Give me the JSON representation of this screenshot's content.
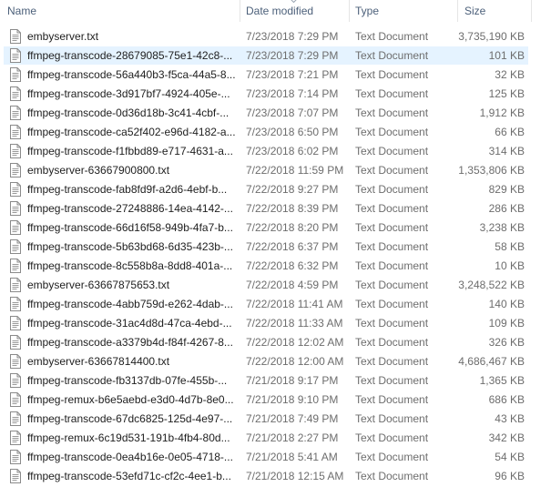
{
  "columns": {
    "name": "Name",
    "date_modified": "Date modified",
    "type": "Type",
    "size": "Size"
  },
  "sort": {
    "column": "date_modified",
    "direction": "descending"
  },
  "selection_color": "#e5f3ff",
  "files": [
    {
      "name": "embyserver.txt",
      "date": "7/23/2018 7:29 PM",
      "type": "Text Document",
      "size": "3,735,190 KB",
      "icon": "text-file-icon",
      "selected": false
    },
    {
      "name": "ffmpeg-transcode-28679085-75e1-42c8-...",
      "date": "7/23/2018 7:29 PM",
      "type": "Text Document",
      "size": "101 KB",
      "icon": "text-file-icon",
      "selected": true
    },
    {
      "name": "ffmpeg-transcode-56a440b3-f5ca-44a5-8...",
      "date": "7/23/2018 7:21 PM",
      "type": "Text Document",
      "size": "32 KB",
      "icon": "text-file-icon",
      "selected": false
    },
    {
      "name": "ffmpeg-transcode-3d917bf7-4924-405e-...",
      "date": "7/23/2018 7:14 PM",
      "type": "Text Document",
      "size": "125 KB",
      "icon": "text-file-icon",
      "selected": false
    },
    {
      "name": "ffmpeg-transcode-0d36d18b-3c41-4cbf-...",
      "date": "7/23/2018 7:07 PM",
      "type": "Text Document",
      "size": "1,912 KB",
      "icon": "text-file-icon",
      "selected": false
    },
    {
      "name": "ffmpeg-transcode-ca52f402-e96d-4182-a...",
      "date": "7/23/2018 6:50 PM",
      "type": "Text Document",
      "size": "66 KB",
      "icon": "text-file-icon",
      "selected": false
    },
    {
      "name": "ffmpeg-transcode-f1fbbd89-e717-4631-a...",
      "date": "7/23/2018 6:02 PM",
      "type": "Text Document",
      "size": "314 KB",
      "icon": "text-file-icon",
      "selected": false
    },
    {
      "name": "embyserver-63667900800.txt",
      "date": "7/22/2018 11:59 PM",
      "type": "Text Document",
      "size": "1,353,806 KB",
      "icon": "text-file-icon",
      "selected": false
    },
    {
      "name": "ffmpeg-transcode-fab8fd9f-a2d6-4ebf-b...",
      "date": "7/22/2018 9:27 PM",
      "type": "Text Document",
      "size": "829 KB",
      "icon": "text-file-icon",
      "selected": false
    },
    {
      "name": "ffmpeg-transcode-27248886-14ea-4142-...",
      "date": "7/22/2018 8:39 PM",
      "type": "Text Document",
      "size": "286 KB",
      "icon": "text-file-icon",
      "selected": false
    },
    {
      "name": "ffmpeg-transcode-66d16f58-949b-4fa7-b...",
      "date": "7/22/2018 8:20 PM",
      "type": "Text Document",
      "size": "3,238 KB",
      "icon": "text-file-icon",
      "selected": false
    },
    {
      "name": "ffmpeg-transcode-5b63bd68-6d35-423b-...",
      "date": "7/22/2018 6:37 PM",
      "type": "Text Document",
      "size": "58 KB",
      "icon": "text-file-icon",
      "selected": false
    },
    {
      "name": "ffmpeg-transcode-8c558b8a-8dd8-401a-...",
      "date": "7/22/2018 6:32 PM",
      "type": "Text Document",
      "size": "10 KB",
      "icon": "text-file-icon",
      "selected": false
    },
    {
      "name": "embyserver-63667875653.txt",
      "date": "7/22/2018 4:59 PM",
      "type": "Text Document",
      "size": "3,248,522 KB",
      "icon": "text-file-icon",
      "selected": false
    },
    {
      "name": "ffmpeg-transcode-4abb759d-e262-4dab-...",
      "date": "7/22/2018 11:41 AM",
      "type": "Text Document",
      "size": "140 KB",
      "icon": "text-file-icon",
      "selected": false
    },
    {
      "name": "ffmpeg-transcode-31ac4d8d-47ca-4ebd-...",
      "date": "7/22/2018 11:33 AM",
      "type": "Text Document",
      "size": "109 KB",
      "icon": "text-file-icon",
      "selected": false
    },
    {
      "name": "ffmpeg-transcode-a3379b4d-f84f-4267-8...",
      "date": "7/22/2018 12:02 AM",
      "type": "Text Document",
      "size": "326 KB",
      "icon": "text-file-icon",
      "selected": false
    },
    {
      "name": "embyserver-63667814400.txt",
      "date": "7/22/2018 12:00 AM",
      "type": "Text Document",
      "size": "4,686,467 KB",
      "icon": "text-file-icon",
      "selected": false
    },
    {
      "name": "ffmpeg-transcode-fb3137db-07fe-455b-...",
      "date": "7/21/2018 9:17 PM",
      "type": "Text Document",
      "size": "1,365 KB",
      "icon": "text-file-icon",
      "selected": false
    },
    {
      "name": "ffmpeg-remux-b6e5aebd-e3d0-4d7b-8e0...",
      "date": "7/21/2018 9:10 PM",
      "type": "Text Document",
      "size": "686 KB",
      "icon": "text-file-icon",
      "selected": false
    },
    {
      "name": "ffmpeg-transcode-67dc6825-125d-4e97-...",
      "date": "7/21/2018 7:49 PM",
      "type": "Text Document",
      "size": "43 KB",
      "icon": "text-file-icon",
      "selected": false
    },
    {
      "name": "ffmpeg-remux-6c19d531-191b-4fb4-80d...",
      "date": "7/21/2018 2:27 PM",
      "type": "Text Document",
      "size": "342 KB",
      "icon": "text-file-icon",
      "selected": false
    },
    {
      "name": "ffmpeg-transcode-0ea4b16e-0e05-4718-...",
      "date": "7/21/2018 5:41 AM",
      "type": "Text Document",
      "size": "54 KB",
      "icon": "text-file-icon",
      "selected": false
    },
    {
      "name": "ffmpeg-transcode-53efd71c-cf2c-4ee1-b...",
      "date": "7/21/2018 12:15 AM",
      "type": "Text Document",
      "size": "96 KB",
      "icon": "text-file-icon",
      "selected": false
    }
  ]
}
